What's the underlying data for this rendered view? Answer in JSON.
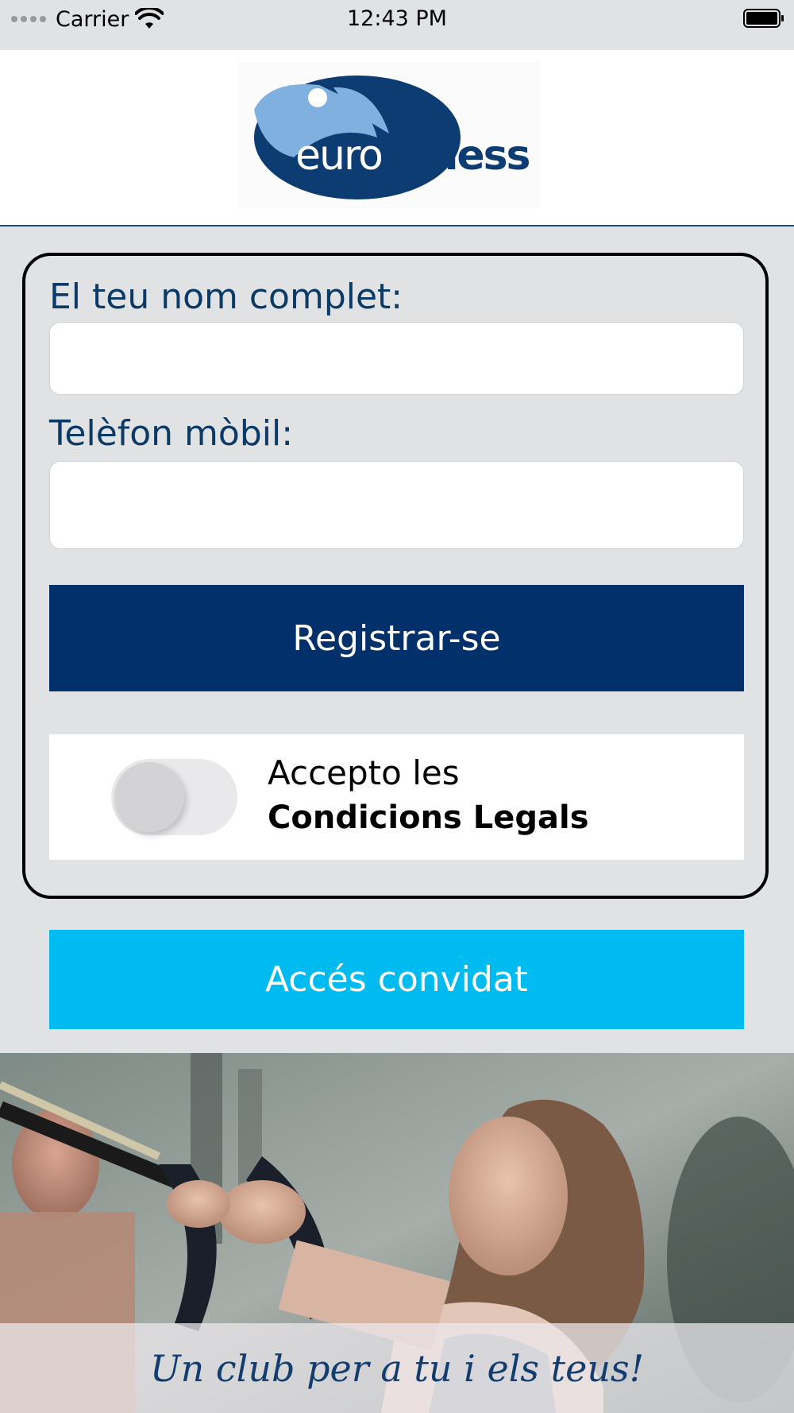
{
  "status_bar": {
    "carrier": "Carrier",
    "time": "12:43 PM"
  },
  "header": {
    "logo_text_part1": "euro",
    "logo_text_part2": "fitness",
    "logo_colors": {
      "dark_blue": "#0c3c72",
      "light_blue": "#7fb0df"
    }
  },
  "form": {
    "name_label": "El teu nom complet:",
    "name_value": "",
    "phone_label": "Telèfon mòbil:",
    "phone_value": "",
    "register_button": "Registrar-se",
    "terms_toggle_on": false,
    "terms_text_line1": "Accepto les",
    "terms_text_line2": "Condicions Legals"
  },
  "guest_button": "Accés convidat",
  "banner": {
    "tagline": "Un club per a tu i els teus!"
  },
  "colors": {
    "background": "#e1e2e4",
    "primary": "#02306a",
    "secondary": "#00bbf0",
    "label": "#0b3a66"
  }
}
